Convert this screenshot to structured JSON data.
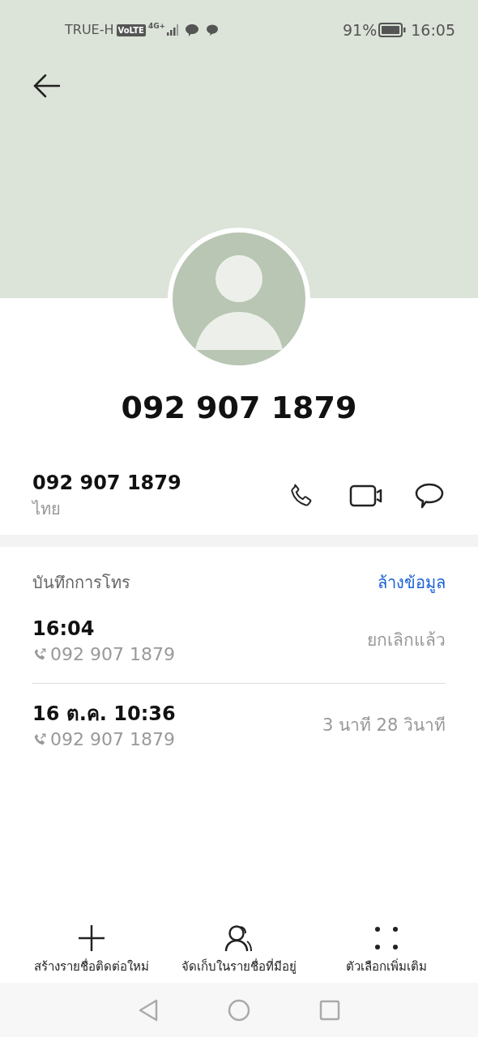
{
  "status_bar": {
    "carrier": "TRUE-H",
    "volte": "VoLTE",
    "network": "4G+",
    "battery": "91%",
    "time": "16:05"
  },
  "contact": {
    "name": "092 907 1879",
    "number": "092 907 1879",
    "region": "ไทย"
  },
  "call_log": {
    "title": "บันทึกการโทร",
    "clear_label": "ล้างข้อมูล",
    "entries": [
      {
        "time": "16:04",
        "number": "092 907 1879",
        "detail": "ยกเลิกแล้ว"
      },
      {
        "time": "16 ต.ค. 10:36",
        "number": "092 907 1879",
        "detail": "3 นาที 28 วินาที"
      }
    ]
  },
  "bottom_actions": [
    {
      "kind": "add",
      "label": "สร้างรายชื่อติดต่อใหม่"
    },
    {
      "kind": "contacts",
      "label": "จัดเก็บในรายชื่อที่มีอยู่"
    },
    {
      "kind": "more",
      "label": "ตัวเลือกเพิ่มเติม"
    }
  ]
}
